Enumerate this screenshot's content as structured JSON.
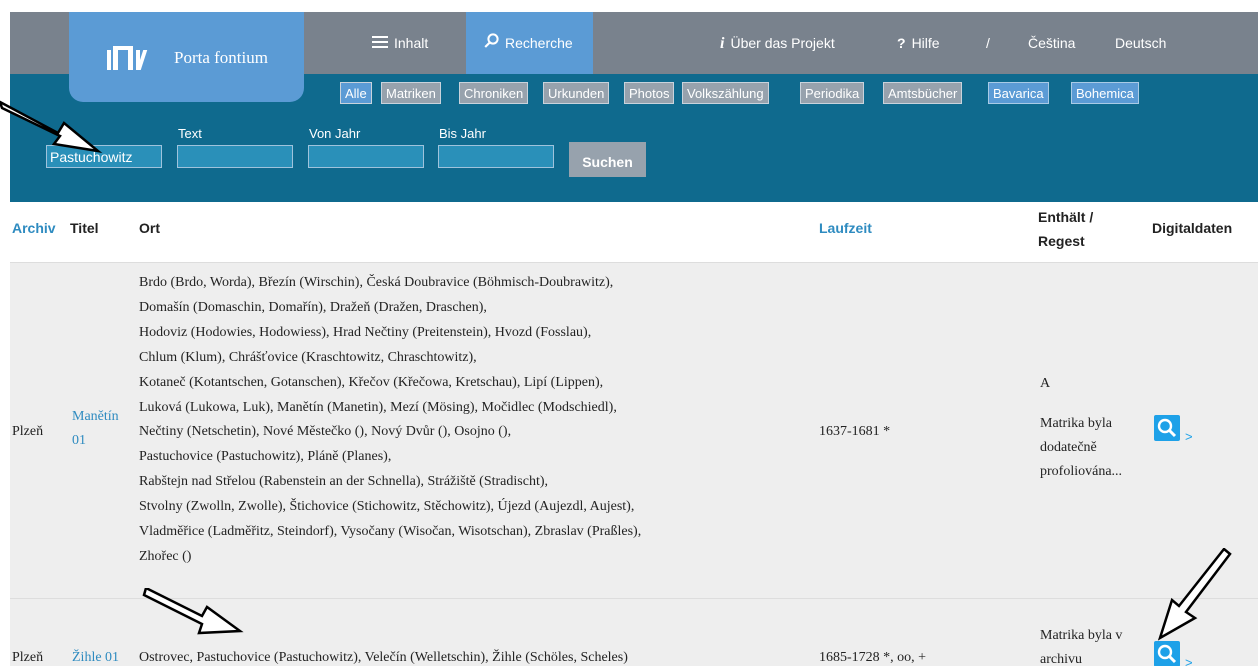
{
  "brand": {
    "name": "Porta fontium"
  },
  "nav": {
    "inhalt": "Inhalt",
    "recherche": "Recherche",
    "about": "Über das Projekt",
    "help": "Hilfe",
    "separator": "/",
    "lang_cs": "Čeština",
    "lang_de": "Deutsch"
  },
  "filters": {
    "tabs": [
      "Alle",
      "Matriken",
      "Chroniken",
      "Urkunden",
      "Photos",
      "Volkszählung",
      "Periodika",
      "Amtsbücher"
    ],
    "active_tab": "Alle",
    "regions": [
      "Bavarica",
      "Bohemica"
    ]
  },
  "search": {
    "ort_value": "Pastuchowitz",
    "text_label": "Text",
    "von_label": "Von Jahr",
    "bis_label": "Bis Jahr",
    "button": "Suchen"
  },
  "table": {
    "headers": {
      "archiv": "Archiv",
      "titel": "Titel",
      "ort": "Ort",
      "laufzeit": "Laufzeit",
      "enthalt_1": "Enthält /",
      "enthalt_2": "Regest",
      "digital": "Digitaldaten"
    },
    "rows": [
      {
        "archiv": "Plzeň",
        "titel_1": "Manětín",
        "titel_2": "01",
        "ort_lines": [
          "Brdo (Brdo, Worda), Březín (Wirschin), Česká Doubravice (Böhmisch-Doubrawitz),",
          "Domašín (Domaschin, Domařín), Dražeň (Dražen, Draschen),",
          "Hodoviz (Hodowies, Hodowiess), Hrad Nečtiny (Preitenstein), Hvozd (Fosslau),",
          "Chlum (Klum), Chrášťovice (Kraschtowitz, Chraschtowitz),",
          "Kotaneč (Kotantschen, Gotanschen), Křečov (Křečowa, Kretschau), Lipí (Lippen),",
          "Luková (Lukowa, Luk), Manětín (Manetin), Mezí (Mösing), Močidlec (Modschiedl),",
          "Nečtiny (Netschetin), Nové Městečko (), Nový Dvůr (), Osojno (),",
          "Pastuchovice (Pastuchowitz), Pláně (Planes),",
          "Rabštejn nad Střelou (Rabenstein an der Schnella), Strážiště (Stradischt),",
          "Stvolny (Zwolln, Zwolle), Štichovice (Stichowitz, Stěchowitz), Újezd (Aujezdl, Aujest),",
          "Vladměřice (Ladměřitz, Steindorf), Vysočany (Wisočan, Wisotschan), Zbraslav (Praßles),",
          "Zhořec ()"
        ],
        "laufzeit": "1637-1681 *",
        "enthalt_code": "A",
        "regest_lines": [
          "Matrika byla",
          "dodatečně",
          "profoliována..."
        ],
        "digi_more": ">"
      },
      {
        "archiv": "Plzeň",
        "titel_1": "Žihle 01",
        "ort": "Ostrovec, Pastuchovice (Pastuchowitz), Velečín (Welletschin), Žihle (Schöles, Scheles)",
        "laufzeit": "1685-1728 *, oo, +",
        "regest_lines": [
          "Matrika byla v",
          "archivu"
        ],
        "digi_more": ">"
      }
    ]
  },
  "colors": {
    "nav_bg": "#79828d",
    "accent": "#5b9bd5",
    "panel_bg": "#0f6a8e",
    "link": "#2e8bc0",
    "row_bg": "#eeeeee",
    "digi_icon": "#1ea1e8"
  },
  "icons": [
    "books-logo-icon",
    "hamburger-icon",
    "search-icon",
    "info-icon",
    "question-icon",
    "magnifier-icon",
    "chevron-right-icon",
    "annotation-arrow-icon"
  ]
}
